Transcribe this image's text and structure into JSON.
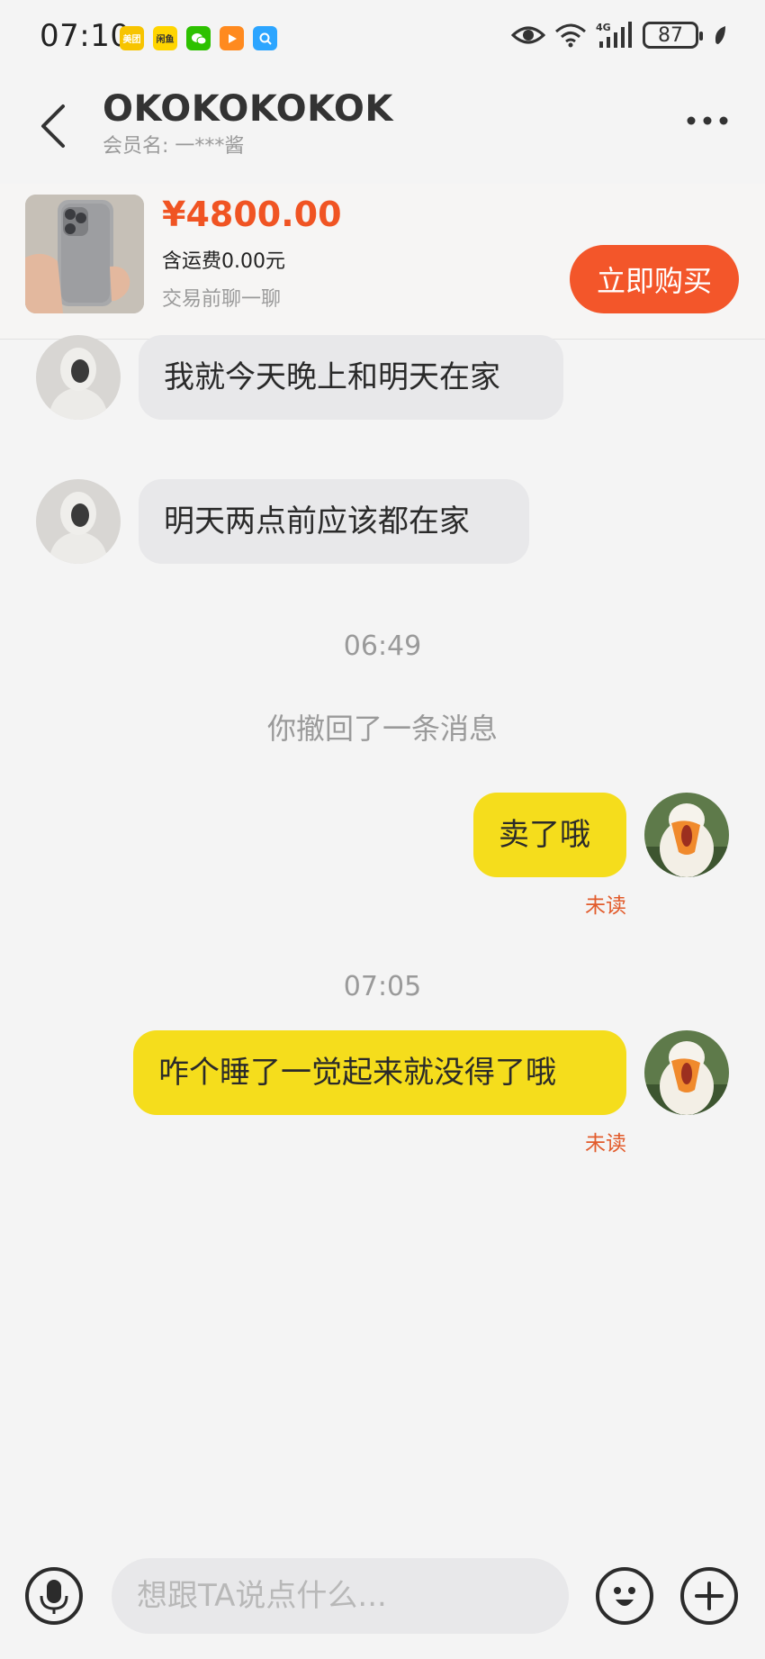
{
  "status_bar": {
    "time": "07:10",
    "apps": [
      {
        "name": "meituan-icon",
        "label": "美团",
        "color": "#f7c400"
      },
      {
        "name": "xianyu-icon",
        "label": "闲鱼",
        "color": "#ffd500"
      },
      {
        "name": "wechat-icon",
        "label": "",
        "color": "#2dc100"
      },
      {
        "name": "video-icon",
        "label": "",
        "color": "#ff8a1f"
      },
      {
        "name": "search-app-icon",
        "label": "",
        "color": "#2ca5ff"
      }
    ],
    "network": "4G",
    "battery": "87"
  },
  "header": {
    "title": "OKOKOKOKOK",
    "subtitle": "会员名: 一***酱"
  },
  "product": {
    "price": "¥4800.00",
    "shipping": "含运费0.00元",
    "tip": "交易前聊一聊",
    "buy_label": "立即购买"
  },
  "messages": {
    "m1": "我就今天晚上和明天在家",
    "m2": "明天两点前应该都在家",
    "t1": "06:49",
    "recall": "你撤回了一条消息",
    "m3": "卖了哦",
    "m3_status": "未读",
    "t2": "07:05",
    "m4": "咋个睡了一觉起来就没得了哦",
    "m4_status": "未读"
  },
  "input": {
    "placeholder": "想跟TA说点什么..."
  },
  "colors": {
    "accent": "#f3562a",
    "price": "#f05423",
    "outgoing_bubble": "#f5dd1c",
    "incoming_bubble": "#e8e8ea",
    "unread": "#e25b2b"
  }
}
